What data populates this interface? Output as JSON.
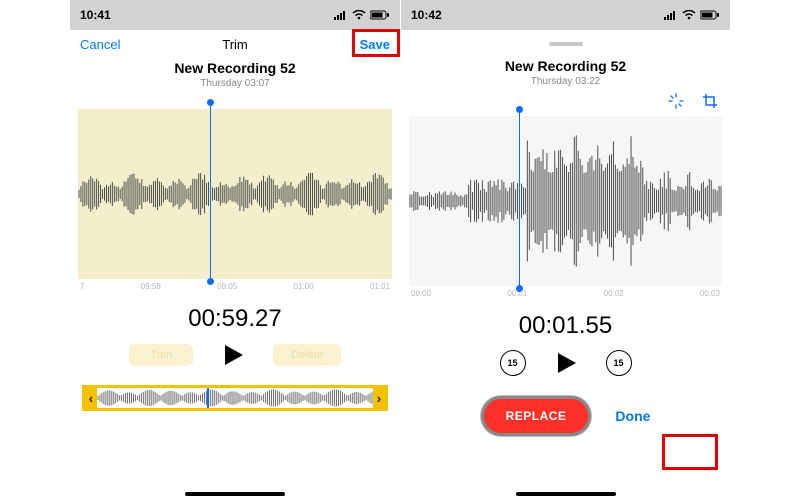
{
  "left": {
    "status_time": "10:41",
    "nav": {
      "cancel": "Cancel",
      "title": "Trim",
      "save": "Save"
    },
    "recording": {
      "title": "New Recording 52",
      "day": "Thursday",
      "duration": "03:07"
    },
    "ticks": [
      "7",
      "09:58",
      "09:05",
      "01:00",
      "01:01"
    ],
    "timecode": "00:59.27",
    "buttons": {
      "trim": "Trim",
      "delete": "Delete"
    }
  },
  "right": {
    "status_time": "10:42",
    "recording": {
      "title": "New Recording 52",
      "day": "Thursday",
      "duration": "03:22"
    },
    "ticks": [
      "00:00",
      "00:01",
      "00:02",
      "00:03"
    ],
    "timecode": "00:01.55",
    "skip_seconds": "15",
    "replace": "REPLACE",
    "done": "Done"
  }
}
